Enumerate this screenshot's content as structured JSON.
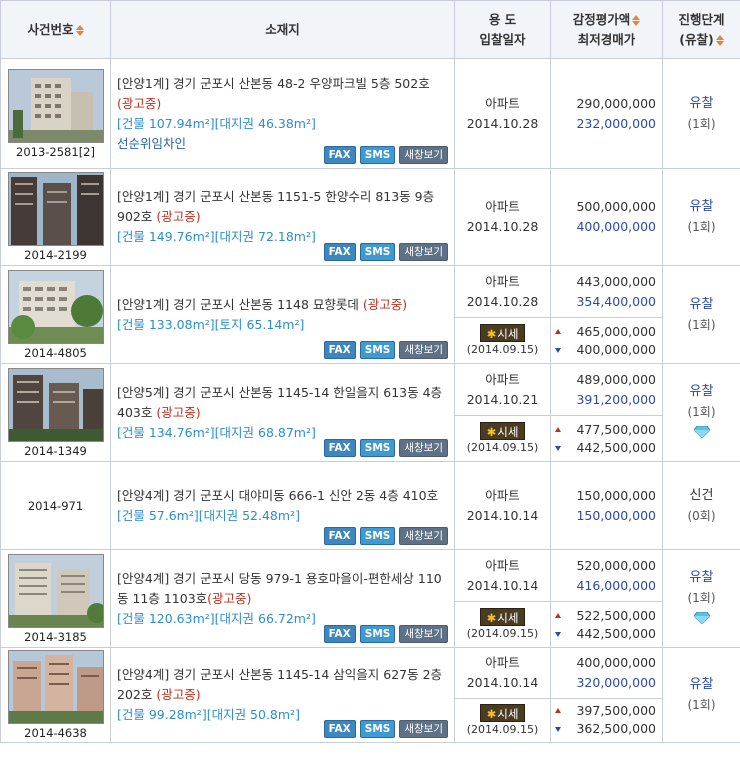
{
  "header": {
    "case_no": "사건번호",
    "location": "소재지",
    "use": "용 도",
    "bid_date": "입찰일자",
    "appraisal": "감정평가액",
    "min_price": "최저경매가",
    "stage": "진행단계",
    "stage_sub": "(유찰)"
  },
  "buttons": {
    "fax": "FAX",
    "sms": "SMS",
    "window": "새창보기"
  },
  "market": {
    "label": "시세",
    "star": "✱",
    "date": "(2014.09.15)"
  },
  "rows": [
    {
      "case_no": "2013-2581",
      "case_sub": "[2]",
      "addr": "[안양1계] 경기 군포시 산본동 48-2 우양파크빌 5층 502호",
      "ad": "(광고중)",
      "area": "[건물 107.94m²][대지권 46.38m²]",
      "owner": "선순위임차인",
      "use": "아파트",
      "date": "2014.10.28",
      "appraisal": "290,000,000",
      "min_price": "232,000,000",
      "stage": "유찰",
      "count": "(1회)"
    },
    {
      "case_no": "2014-2199",
      "addr": "[안양1계] 경기 군포시 산본동 1151-5 한양수리 813동 9층 902호",
      "ad": "(광고중)",
      "area": "[건물 149.76m²][대지권 72.18m²]",
      "use": "아파트",
      "date": "2014.10.28",
      "appraisal": "500,000,000",
      "min_price": "400,000,000",
      "stage": "유찰",
      "count": "(1회)"
    },
    {
      "case_no": "2014-4805",
      "addr": "[안양1계] 경기 군포시 산본동 1148 묘향롯데",
      "ad": "(광고중)",
      "area": "[건물 133.08m²][토지 65.14m²]",
      "use": "아파트",
      "date": "2014.10.28",
      "appraisal": "443,000,000",
      "min_price": "354,400,000",
      "mkt_high": "465,000,000",
      "mkt_low": "400,000,000",
      "stage": "유찰",
      "count": "(1회)"
    },
    {
      "case_no": "2014-1349",
      "addr": "[안양5계] 경기 군포시 산본동 1145-14 한일을지 613동 4층 403호",
      "ad": "(광고중)",
      "area": "[건물 134.76m²][대지권 68.87m²]",
      "use": "아파트",
      "date": "2014.10.21",
      "appraisal": "489,000,000",
      "min_price": "391,200,000",
      "mkt_high": "477,500,000",
      "mkt_low": "442,500,000",
      "stage": "유찰",
      "count": "(1회)"
    },
    {
      "case_no": "2014-971",
      "addr": "[안양4계] 경기 군포시 대야미동 666-1 신안 2동 4층 410호",
      "area": "[건물 57.6m²][대지권 52.48m²]",
      "use": "아파트",
      "date": "2014.10.14",
      "appraisal": "150,000,000",
      "min_price": "150,000,000",
      "stage": "신건",
      "count": "(0회)"
    },
    {
      "case_no": "2014-3185",
      "addr": "[안양4계] 경기 군포시 당동 979-1 용호마을이-편한세상 110동 11층 1103호",
      "ad": "(광고중)",
      "area": "[건물 120.63m²][대지권 66.72m²]",
      "use": "아파트",
      "date": "2014.10.14",
      "appraisal": "520,000,000",
      "min_price": "416,000,000",
      "mkt_high": "522,500,000",
      "mkt_low": "442,500,000",
      "stage": "유찰",
      "count": "(1회)"
    },
    {
      "case_no": "2014-4638",
      "addr": "[안양4계] 경기 군포시 산본동 1145-14 삼익을지 627동 2층 202호",
      "ad": "(광고중)",
      "area": "[건물 99.28m²][대지권 50.8m²]",
      "use": "아파트",
      "date": "2014.10.14",
      "appraisal": "400,000,000",
      "min_price": "320,000,000",
      "mkt_high": "397,500,000",
      "mkt_low": "362,500,000",
      "stage": "유찰",
      "count": "(1회)"
    }
  ]
}
